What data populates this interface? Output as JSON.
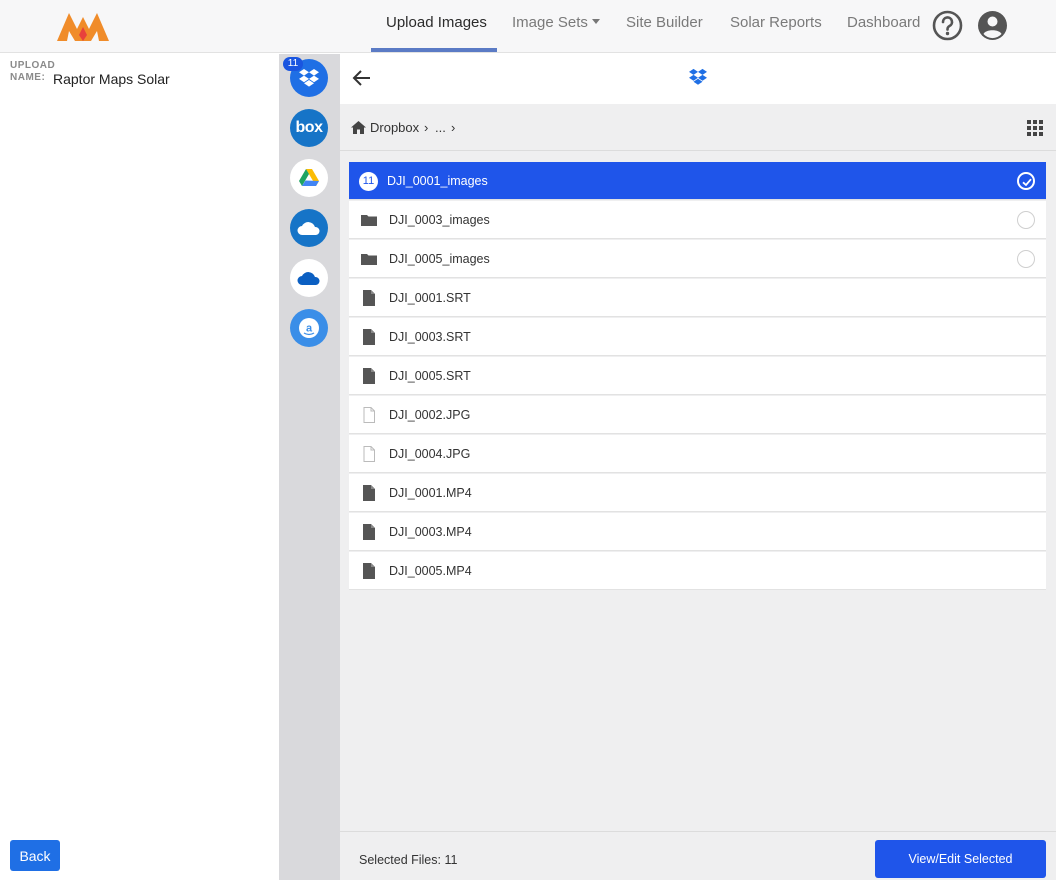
{
  "nav": {
    "items": [
      {
        "label": "Upload Images",
        "active": true
      },
      {
        "label": "Image Sets",
        "dropdown": true
      },
      {
        "label": "Site Builder"
      },
      {
        "label": "Solar Reports"
      },
      {
        "label": "Dashboard"
      }
    ],
    "icons": [
      "help-icon",
      "account-icon"
    ]
  },
  "left": {
    "upload_label_1": "UPLOAD",
    "upload_label_2": "NAME:",
    "upload_name": "Raptor Maps Solar",
    "back_button": "Back"
  },
  "providers": {
    "badge": "11",
    "items": [
      "dropbox",
      "box",
      "google-drive",
      "onedrive-business",
      "onedrive",
      "amazon-drive"
    ],
    "box_text": "box"
  },
  "picker": {
    "breadcrumb": {
      "root": "Dropbox",
      "sep1": "›",
      "middle": "...",
      "sep2": "›"
    },
    "files": [
      {
        "name": "DJI_0001_images",
        "type": "folder",
        "selected": true,
        "count": "11"
      },
      {
        "name": "DJI_0003_images",
        "type": "folder",
        "selected": false
      },
      {
        "name": "DJI_0005_images",
        "type": "folder",
        "selected": false
      },
      {
        "name": "DJI_0001.SRT",
        "type": "file"
      },
      {
        "name": "DJI_0003.SRT",
        "type": "file"
      },
      {
        "name": "DJI_0005.SRT",
        "type": "file"
      },
      {
        "name": "DJI_0002.JPG",
        "type": "image"
      },
      {
        "name": "DJI_0004.JPG",
        "type": "image"
      },
      {
        "name": "DJI_0001.MP4",
        "type": "file"
      },
      {
        "name": "DJI_0003.MP4",
        "type": "file"
      },
      {
        "name": "DJI_0005.MP4",
        "type": "file"
      }
    ],
    "footer_text": "Selected Files: 11",
    "footer_button": "View/Edit Selected"
  },
  "colors": {
    "accent": "#1f55ea",
    "nav_underline": "#5b7bc5",
    "logo": "#f08c2a"
  }
}
